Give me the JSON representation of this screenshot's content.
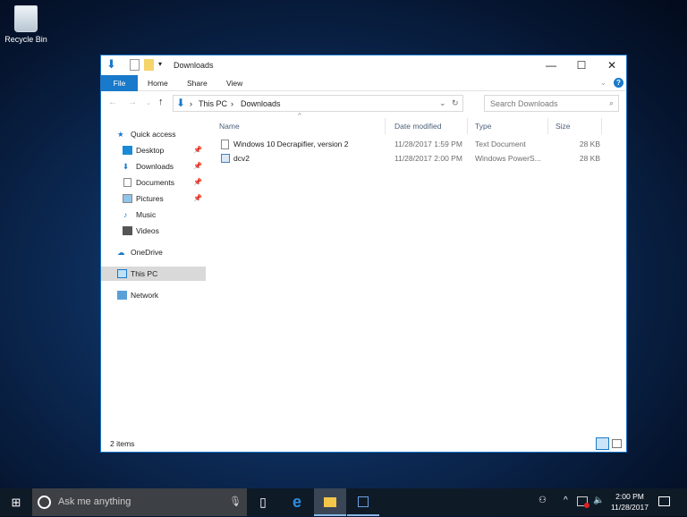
{
  "desktop": {
    "recycle_bin": "Recycle Bin"
  },
  "window": {
    "title": "Downloads",
    "minimize": "—",
    "maximize": "☐",
    "close": "✕",
    "ribbon_tabs": [
      "File",
      "Home",
      "Share",
      "View"
    ],
    "address": {
      "segments": [
        "This PC",
        "Downloads"
      ],
      "separator": "›"
    },
    "search_placeholder": "Search Downloads",
    "nav": [
      {
        "label": "Quick access"
      },
      {
        "label": "Desktop",
        "pinned": true
      },
      {
        "label": "Downloads",
        "pinned": true
      },
      {
        "label": "Documents",
        "pinned": true
      },
      {
        "label": "Pictures",
        "pinned": true
      },
      {
        "label": "Music"
      },
      {
        "label": "Videos"
      },
      {
        "label": "OneDrive"
      },
      {
        "label": "This PC",
        "selected": true
      },
      {
        "label": "Network"
      }
    ],
    "columns": [
      "Name",
      "Date modified",
      "Type",
      "Size"
    ],
    "files": [
      {
        "name": "Windows 10 Decrapifier, version 2",
        "date": "11/28/2017 1:59 PM",
        "type": "Text Document",
        "size": "28 KB"
      },
      {
        "name": "dcv2",
        "date": "11/28/2017 2:00 PM",
        "type": "Windows PowerS...",
        "size": "28 KB"
      }
    ],
    "status": "2 items"
  },
  "taskbar": {
    "search_placeholder": "Ask me anything",
    "time": "2:00 PM",
    "date": "11/28/2017"
  },
  "colors": {
    "accent": "#1979ca",
    "taskbar": "#0f1a27"
  }
}
